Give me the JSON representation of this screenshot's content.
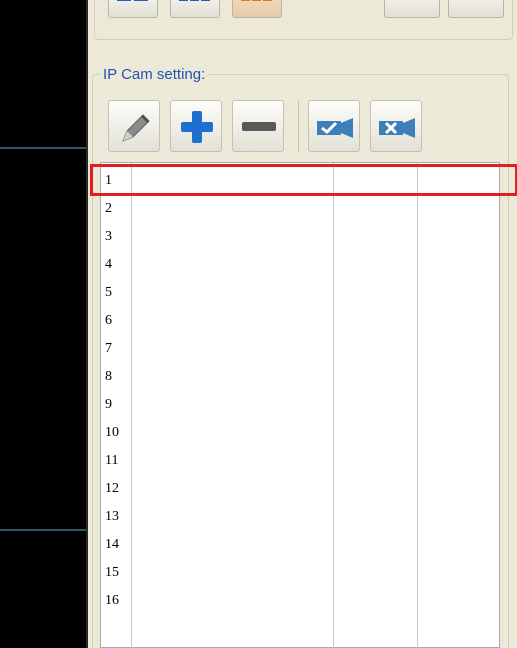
{
  "layout_toolbar": {
    "buttons": [
      {
        "id": "layout-4",
        "icon": "grid-layout-icon",
        "color": "#1f5fb8",
        "active": false
      },
      {
        "id": "layout-6",
        "icon": "grid-layout-icon",
        "color": "#1f5fb8",
        "active": false
      },
      {
        "id": "layout-9",
        "icon": "grid-layout-icon",
        "color": "#e07a1a",
        "active": true
      },
      {
        "id": "layout-prev",
        "icon": "blank-button-icon",
        "active": false
      },
      {
        "id": "layout-next",
        "icon": "blank-button-icon",
        "active": false
      }
    ]
  },
  "ipcam": {
    "title": "IP Cam setting:",
    "tools": [
      {
        "id": "edit",
        "icon": "pencil-icon"
      },
      {
        "id": "add",
        "icon": "plus-icon"
      },
      {
        "id": "remove",
        "icon": "minus-icon"
      },
      {
        "id": "connect",
        "icon": "camera-check-icon"
      },
      {
        "id": "disconnect",
        "icon": "camera-x-icon"
      }
    ],
    "rows": [
      "1",
      "2",
      "3",
      "4",
      "5",
      "6",
      "7",
      "8",
      "9",
      "10",
      "11",
      "12",
      "13",
      "14",
      "15",
      "16"
    ],
    "selected_row": "1"
  },
  "colors": {
    "panel_bg": "#ece9d8",
    "title_blue": "#2550b4",
    "highlight": "#e02020",
    "video_bg": "#000000"
  }
}
